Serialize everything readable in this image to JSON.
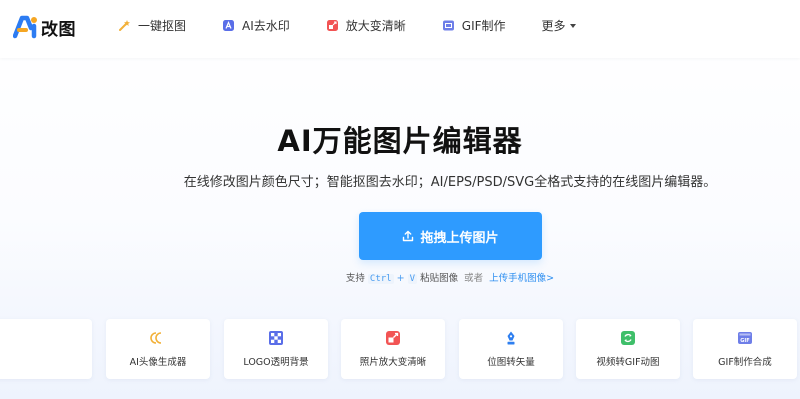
{
  "header": {
    "logo_text": "改图",
    "nav": [
      {
        "label": "一键抠图",
        "icon": "magic-wand-icon"
      },
      {
        "label": "AI去水印",
        "icon": "ai-watermark-icon"
      },
      {
        "label": "放大变清晰",
        "icon": "enlarge-icon"
      },
      {
        "label": "GIF制作",
        "icon": "gif-icon"
      },
      {
        "label": "更多",
        "icon": "chevron-down-icon"
      }
    ]
  },
  "hero": {
    "title": "AI万能图片编辑器",
    "subtitle": "在线修改图片颜色尺寸；智能抠图去水印；AI/EPS/PSD/SVG全格式支持的在线图片编辑器。",
    "upload_label": "拖拽上传图片",
    "paste_prefix": "支持",
    "key_ctrl": "Ctrl",
    "key_plus": "+",
    "key_v": "V",
    "paste_suffix": "粘贴图像",
    "or": "或者",
    "phone_link": "上传手机图像>"
  },
  "tools": [
    {
      "label": "AI头像生成器",
      "icon": "ai-avatar-icon",
      "color": "#f2b13a"
    },
    {
      "label": "LOGO透明背景",
      "icon": "transparent-bg-icon",
      "color": "#5a6ee8"
    },
    {
      "label": "照片放大变清晰",
      "icon": "enlarge-icon",
      "color": "#f25454"
    },
    {
      "label": "位图转矢量",
      "icon": "vector-pen-icon",
      "color": "#2e7ff0"
    },
    {
      "label": "视频转GIF动图",
      "icon": "video-gif-icon",
      "color": "#3fbf6a"
    },
    {
      "label": "GIF制作合成",
      "icon": "gif-icon",
      "color": "#6e7ee8"
    }
  ],
  "colors": {
    "primary": "#2e9bff",
    "link": "#2e8ff0"
  }
}
